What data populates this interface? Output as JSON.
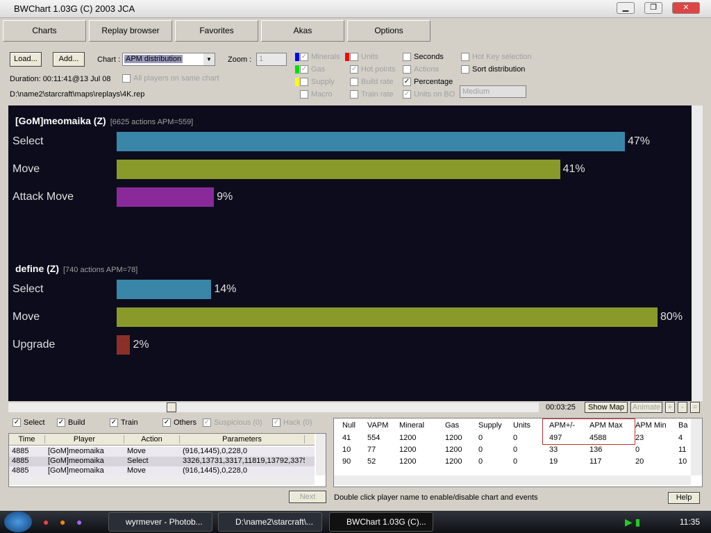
{
  "window": {
    "title": "BWChart 1.03G (C) 2003 JCA"
  },
  "tabs": [
    "Charts",
    "Replay browser",
    "Favorites",
    "Akas",
    "Options"
  ],
  "controls": {
    "load": "Load...",
    "add": "Add...",
    "chart_label": "Chart :",
    "chart_value": "APM distribution",
    "zoom_label": "Zoom :",
    "zoom_value": "1",
    "duration": "Duration: 00:11:41@13 Jul 08",
    "all_players": "All players on same chart",
    "path": "D:\\name2\\starcraft\\maps\\replays\\4K.rep",
    "options": [
      {
        "label": "Minerals",
        "checked": true,
        "enabled": false,
        "color": "#0000ff"
      },
      {
        "label": "Gas",
        "checked": true,
        "enabled": false,
        "color": "#00e000"
      },
      {
        "label": "Supply",
        "checked": false,
        "enabled": false,
        "color": "#ffff00"
      },
      {
        "label": "Macro",
        "checked": false,
        "enabled": false
      },
      {
        "label": "Units",
        "checked": false,
        "enabled": false,
        "color": "#ff0000"
      },
      {
        "label": "Hot points",
        "checked": true,
        "enabled": false
      },
      {
        "label": "Build rate",
        "checked": false,
        "enabled": false
      },
      {
        "label": "Train rate",
        "checked": false,
        "enabled": false
      },
      {
        "label": "Seconds",
        "checked": false,
        "enabled": true
      },
      {
        "label": "Actions",
        "checked": false,
        "enabled": false
      },
      {
        "label": "Percentage",
        "checked": true,
        "enabled": true
      },
      {
        "label": "Units on BO",
        "checked": true,
        "enabled": false
      },
      {
        "label": "Hot Key selection",
        "checked": false,
        "enabled": false
      },
      {
        "label": "Sort distribution",
        "checked": false,
        "enabled": true
      }
    ],
    "speed": "Medium"
  },
  "chart_data": {
    "type": "bar",
    "players": [
      {
        "name": "[GoM]meomaika (Z)",
        "info": "[6625 actions APM=559]",
        "categories": [
          "Select",
          "Move",
          "Attack Move"
        ],
        "values": [
          47,
          41,
          9
        ],
        "colors": [
          "#3a86a8",
          "#8a9a2a",
          "#8a2a9a"
        ]
      },
      {
        "name": "define (Z)",
        "info": "[740 actions APM=78]",
        "categories": [
          "Select",
          "Move",
          "Upgrade"
        ],
        "values": [
          14,
          80,
          2
        ],
        "colors": [
          "#3a86a8",
          "#8a9a2a",
          "#8a3028"
        ]
      }
    ]
  },
  "timeline": {
    "time": "00:03:25",
    "show_map": "Show Map",
    "animate": "Animate",
    "plus": "+",
    "minus": "-",
    "equals": "="
  },
  "filters": [
    {
      "label": "Select",
      "checked": true,
      "enabled": true
    },
    {
      "label": "Build",
      "checked": true,
      "enabled": true
    },
    {
      "label": "Train",
      "checked": true,
      "enabled": true
    },
    {
      "label": "Others",
      "checked": true,
      "enabled": true
    },
    {
      "label": "Suspicious (0)",
      "checked": true,
      "enabled": false
    },
    {
      "label": "Hack (0)",
      "checked": true,
      "enabled": false
    }
  ],
  "events": {
    "headers": [
      "Time",
      "Player",
      "Action",
      "Parameters"
    ],
    "rows": [
      [
        "4885",
        "[GoM]meomaika",
        "Move",
        "(916,1445),0,228,0"
      ],
      [
        "4885",
        "[GoM]meomaika",
        "Select",
        "3326,13731,3317,11819,13792,3375"
      ],
      [
        "4885",
        "[GoM]meomaika",
        "Move",
        "(916,1445),0,228,0"
      ]
    ]
  },
  "stats": {
    "headers": [
      "Null",
      "VAPM",
      "Mineral",
      "Gas",
      "Supply",
      "Units",
      "APM+/-",
      "APM Max",
      "APM Min",
      "Ba"
    ],
    "rows": [
      [
        "41",
        "554",
        "1200",
        "1200",
        "0",
        "0",
        "497",
        "4588",
        "23",
        "4"
      ],
      [
        "10",
        "77",
        "1200",
        "1200",
        "0",
        "0",
        "33",
        "136",
        "0",
        "11"
      ],
      [
        "90",
        "52",
        "1200",
        "1200",
        "0",
        "0",
        "19",
        "117",
        "20",
        "10"
      ]
    ]
  },
  "footer": {
    "next": "Next",
    "hint": "Double click player name to enable/disable chart and events",
    "help": "Help"
  },
  "taskbar": {
    "tasks": [
      "wyrmever - Photob...",
      "D:\\name2\\starcraft\\...",
      "BWChart 1.03G (C)..."
    ],
    "clock": "11:35"
  }
}
